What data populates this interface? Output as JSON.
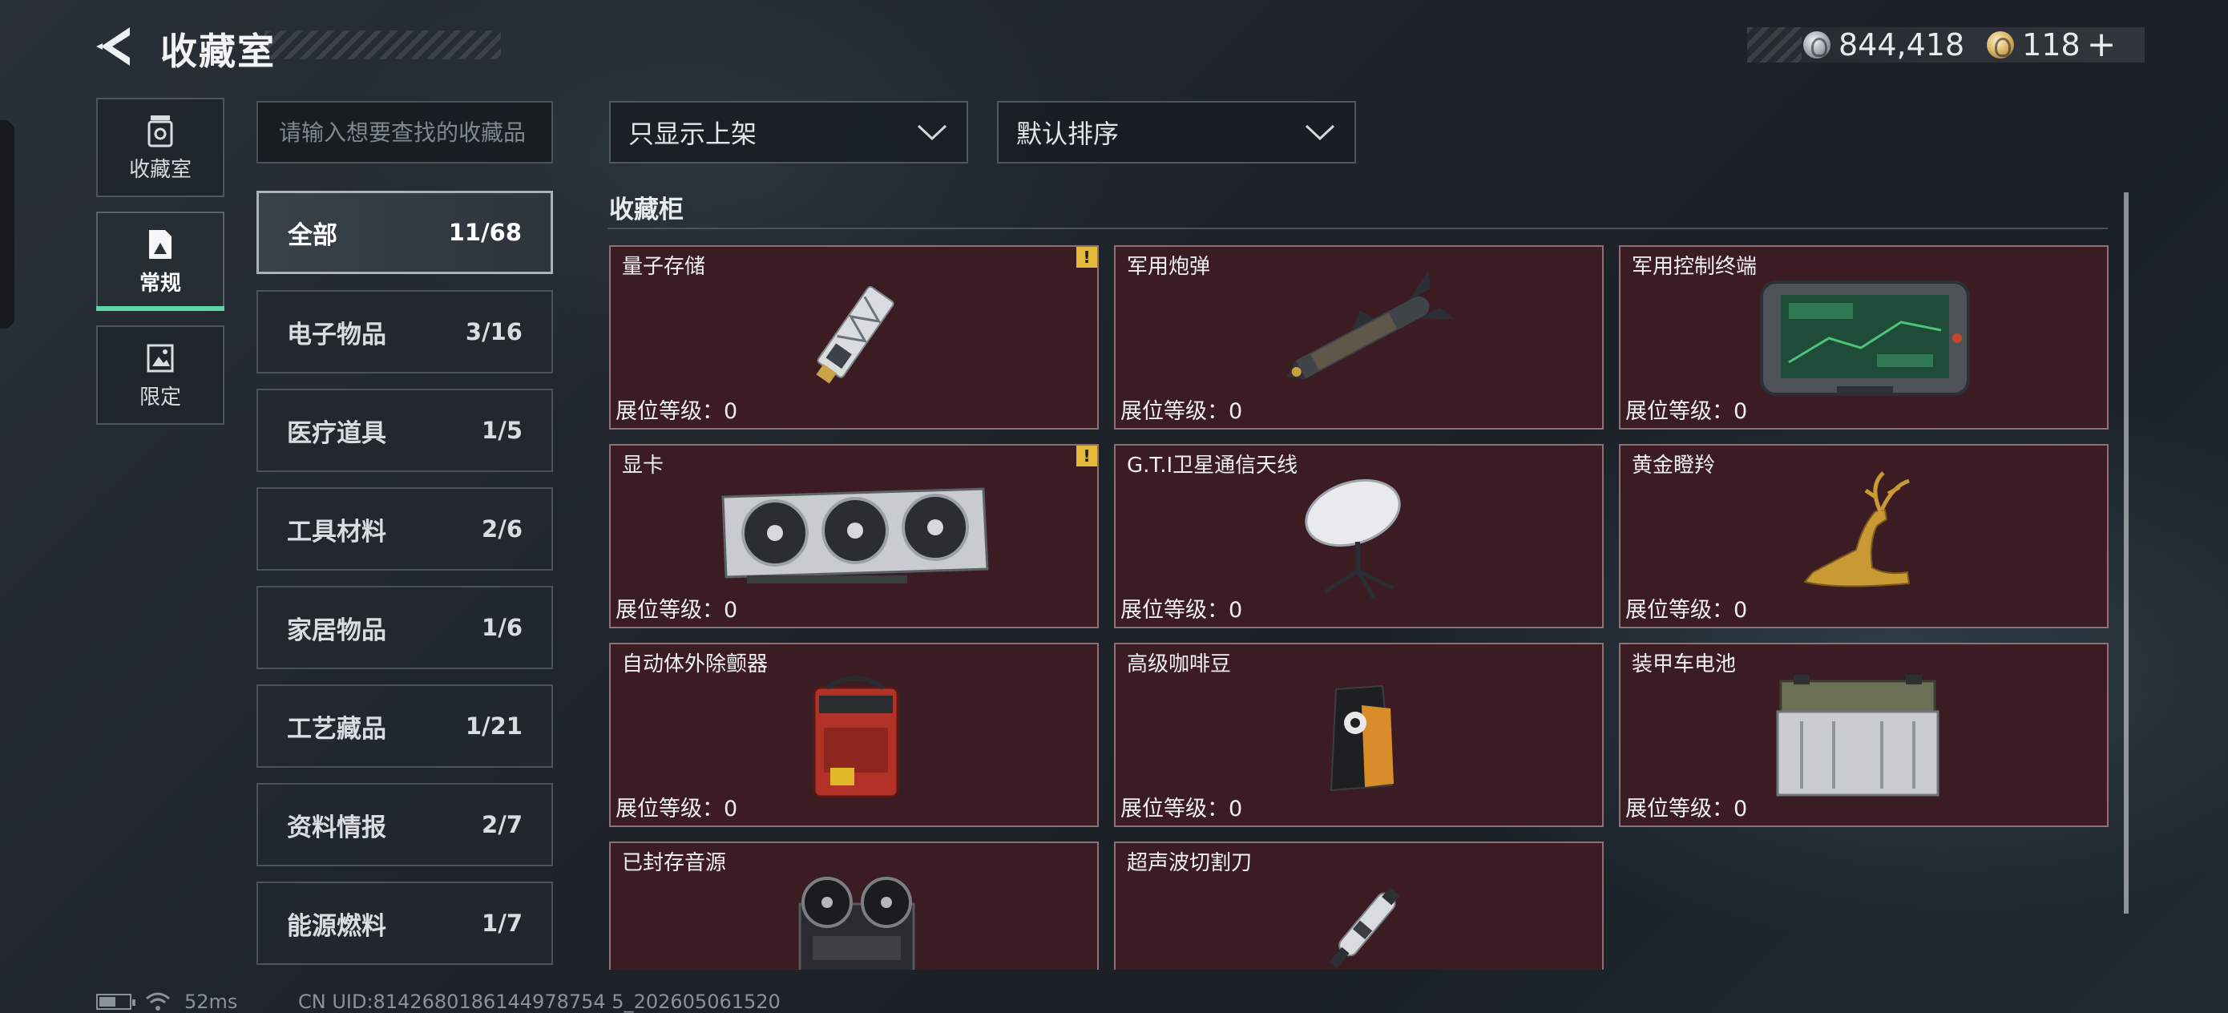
{
  "header": {
    "title": "收藏室",
    "back_icon": "back-arrow-icon"
  },
  "currency": [
    {
      "value": "844,418",
      "icon": "silver-coin-icon",
      "color": "#b8c0c8"
    },
    {
      "value": "118",
      "icon": "gold-coin-icon",
      "color": "#d3aa57"
    }
  ],
  "currency_plus": "+",
  "nav": [
    {
      "label": "收藏室",
      "icon": "collection-room-icon",
      "active": false
    },
    {
      "label": "常规",
      "icon": "regular-icon",
      "active": true
    },
    {
      "label": "限定",
      "icon": "limited-icon",
      "active": false
    }
  ],
  "search": {
    "placeholder": "请输入想要查找的收藏品",
    "value": ""
  },
  "categories": [
    {
      "name": "全部",
      "count": "11/68",
      "active": true
    },
    {
      "name": "电子物品",
      "count": "3/16"
    },
    {
      "name": "医疗道具",
      "count": "1/5"
    },
    {
      "name": "工具材料",
      "count": "2/6"
    },
    {
      "name": "家居物品",
      "count": "1/6"
    },
    {
      "name": "工艺藏品",
      "count": "1/21"
    },
    {
      "name": "资料情报",
      "count": "2/7"
    },
    {
      "name": "能源燃料",
      "count": "1/7"
    }
  ],
  "filters": {
    "display": "只显示上架",
    "sort": "默认排序"
  },
  "cabinet": {
    "title": "收藏柜",
    "items": [
      {
        "name": "量子存储",
        "level": "展位等级：0",
        "warn": "!",
        "icon": "quantum-storage-icon"
      },
      {
        "name": "军用炮弹",
        "level": "展位等级：0",
        "icon": "military-shell-icon"
      },
      {
        "name": "军用控制终端",
        "level": "展位等级：0",
        "icon": "military-terminal-icon"
      },
      {
        "name": "显卡",
        "level": "展位等级：0",
        "warn": "!",
        "icon": "graphics-card-icon"
      },
      {
        "name": "G.T.I卫星通信天线",
        "level": "展位等级：0",
        "icon": "satellite-dish-icon"
      },
      {
        "name": "黄金瞪羚",
        "level": "展位等级：0",
        "icon": "golden-gazelle-icon"
      },
      {
        "name": "自动体外除颤器",
        "level": "展位等级：0",
        "icon": "defibrillator-icon"
      },
      {
        "name": "高级咖啡豆",
        "level": "展位等级：0",
        "icon": "coffee-bag-icon"
      },
      {
        "name": "装甲车电池",
        "level": "展位等级：0",
        "icon": "vehicle-battery-icon"
      },
      {
        "name": "已封存音源",
        "level": "",
        "icon": "reel-recorder-icon"
      },
      {
        "name": "超声波切割刀",
        "level": "",
        "icon": "ultrasonic-cutter-icon"
      }
    ]
  },
  "status": {
    "ping": "52ms",
    "uid": "CN UID:8142680186144978754 5_202605061520"
  }
}
